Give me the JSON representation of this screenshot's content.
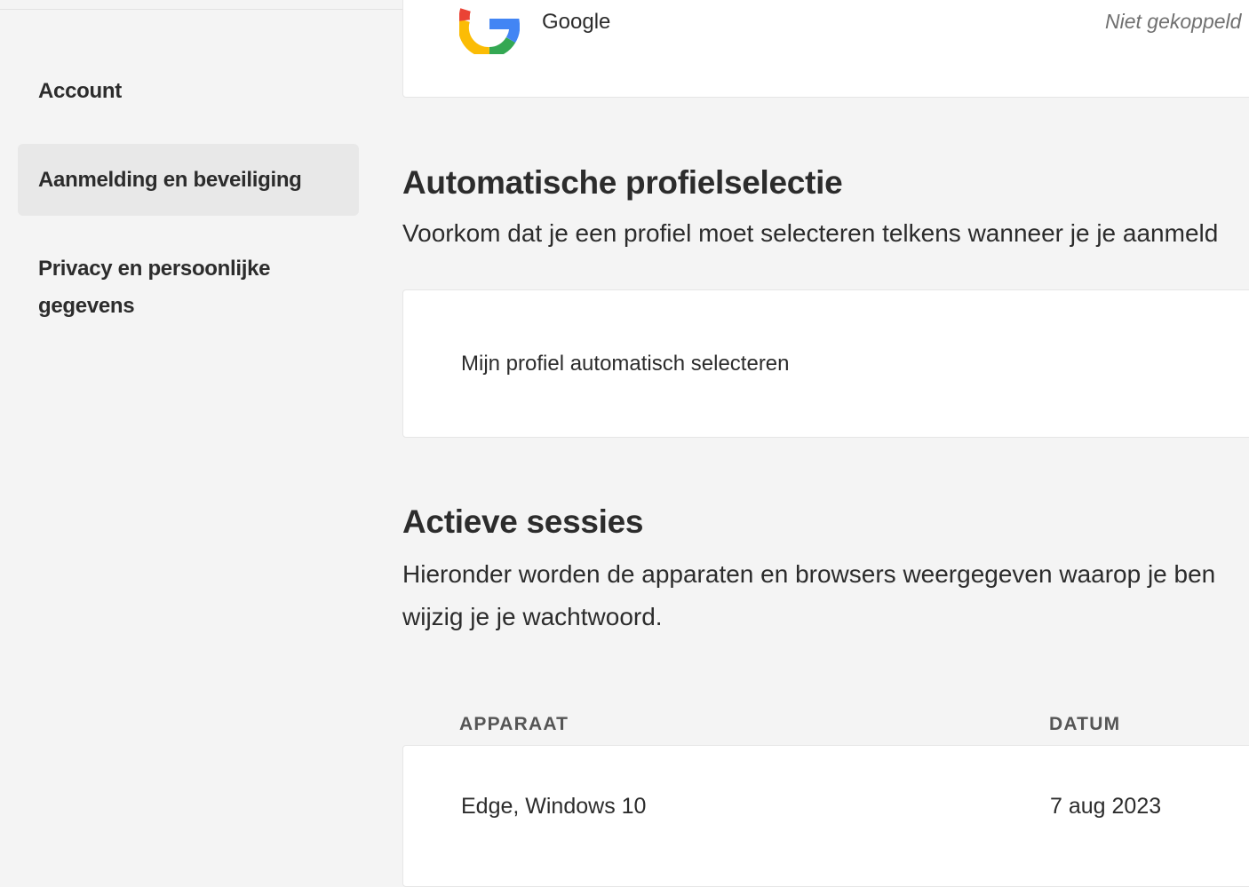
{
  "sidebar": {
    "items": [
      {
        "label": "Account"
      },
      {
        "label": "Aanmelding en beveiliging"
      },
      {
        "label": "Privacy en persoonlijke gegevens"
      }
    ]
  },
  "linked_accounts": {
    "google": {
      "name": "Google",
      "status": "Niet gekoppeld"
    }
  },
  "auto_profile": {
    "title": "Automatische profielselectie",
    "description": "Voorkom dat je een profiel moet selecteren telkens wanneer je je aanmeld",
    "option_label": "Mijn profiel automatisch selecteren"
  },
  "sessions": {
    "title": "Actieve sessies",
    "description_line1": "Hieronder worden de apparaten en browsers weergegeven waarop je ben",
    "description_line2": "wijzig je je wachtwoord.",
    "columns": {
      "device": "APPARAAT",
      "date": "DATUM"
    },
    "rows": [
      {
        "device": "Edge, Windows 10",
        "date": "7 aug 2023"
      }
    ]
  },
  "colors": {
    "background": "#f4f4f4",
    "card": "#ffffff",
    "active_sidebar": "#e8e8e8",
    "text": "#2c2c2c"
  }
}
